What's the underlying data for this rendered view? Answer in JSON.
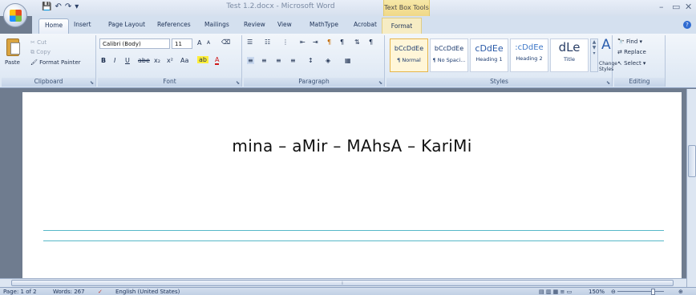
{
  "window": {
    "title": "Test 1.2.docx - Microsoft Word",
    "context_tab_group": "Text Box Tools",
    "controls": {
      "minimize": "–",
      "maximize": "▭",
      "close": "✕"
    }
  },
  "quick_access": {
    "save": "💾",
    "undo": "↶",
    "redo": "↷",
    "more": "▾"
  },
  "tabs": [
    "Home",
    "Insert",
    "Page Layout",
    "References",
    "Mailings",
    "Review",
    "View",
    "MathType",
    "Acrobat",
    "Format"
  ],
  "ribbon": {
    "clipboard": {
      "label": "Clipboard",
      "paste": "Paste",
      "cut": "Cut",
      "copy": "Copy",
      "format_painter": "Format Painter"
    },
    "font": {
      "label": "Font",
      "font_name": "Calibri (Body)",
      "font_size": "11",
      "bold": "B",
      "italic": "I",
      "underline": "U",
      "strike": "abe",
      "subscript": "x₂",
      "superscript": "x²",
      "change_case": "Aa",
      "grow": "A",
      "shrink": "A"
    },
    "paragraph": {
      "label": "Paragraph"
    },
    "styles": {
      "label": "Styles",
      "items": [
        {
          "sample": "bCcDdEe",
          "name": "¶ Normal"
        },
        {
          "sample": "bCcDdEe",
          "name": "¶ No Spaci..."
        },
        {
          "sample": "cDdEe",
          "name": "Heading 1"
        },
        {
          "sample": ":cDdEe",
          "name": "Heading 2"
        },
        {
          "sample": "dLe",
          "name": "Title"
        }
      ],
      "change_styles": "Change Styles"
    },
    "editing": {
      "label": "Editing",
      "find": "Find",
      "replace": "Replace",
      "select": "Select"
    }
  },
  "document": {
    "text": "mina – aMir – MAhsA – KariMi"
  },
  "statusbar": {
    "page": "Page: 1 of 2",
    "words": "Words: 267",
    "language": "English (United States)",
    "zoom": "150%"
  }
}
